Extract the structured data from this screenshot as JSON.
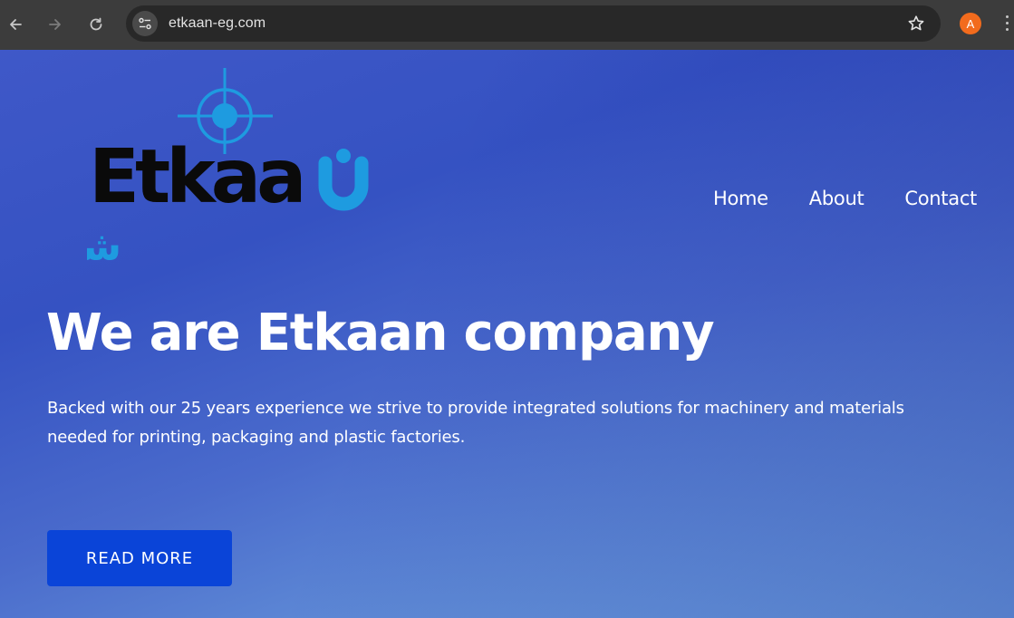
{
  "browser": {
    "url": "etkaan-eg.com",
    "profile_initial": "A",
    "icons": [
      "back-arrow-icon",
      "forward-arrow-icon",
      "reload-icon",
      "site-settings-icon",
      "bookmark-star-icon",
      "more-vert-icon"
    ]
  },
  "logo": {
    "wordmark": "Etkaan",
    "arabic": "شركة إتقان"
  },
  "nav": {
    "items": [
      {
        "label": "Home"
      },
      {
        "label": "About"
      },
      {
        "label": "Contact"
      }
    ]
  },
  "hero": {
    "title": "We are Etkaan company",
    "text": "Backed with our 25 years experience we strive to provide integrated solutions for machinery and materials needed for printing, packaging and plastic factories.",
    "button_label": "READ MORE"
  },
  "colors": {
    "chrome_bg": "#3c3c3c",
    "omnibox_bg": "#282828",
    "avatar_bg": "#f26b1d",
    "button_bg": "#0a44d8",
    "logo_blue": "#1e9be0"
  }
}
